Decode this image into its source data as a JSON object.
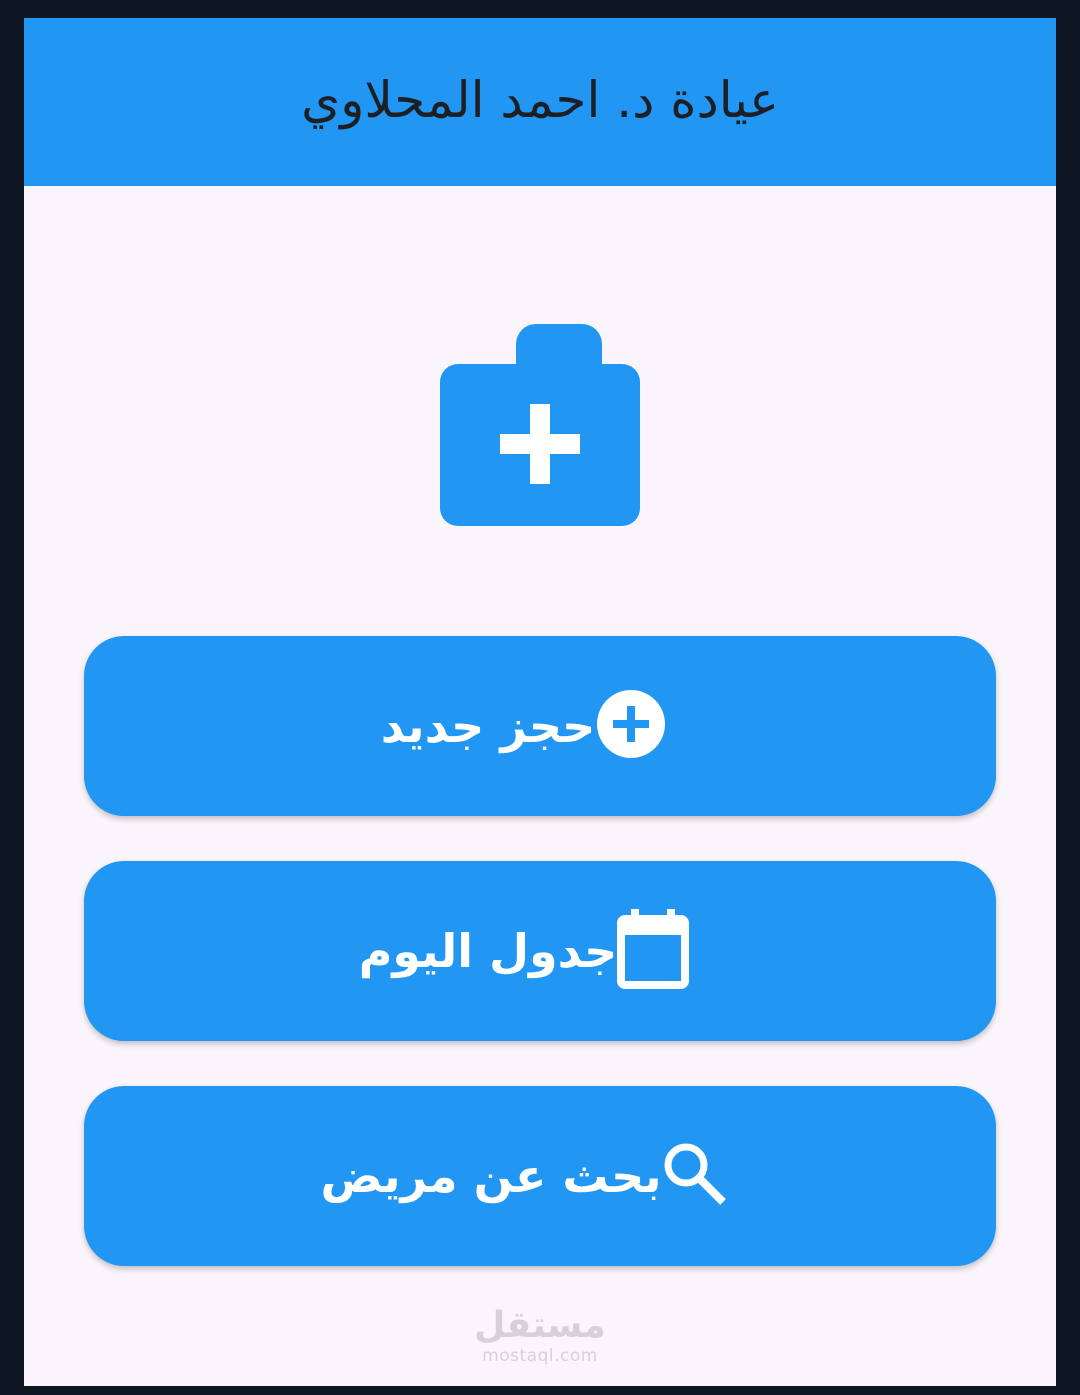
{
  "app_bar": {
    "title": "عيادة د. احمد المحلاوي",
    "color": "#2196f3"
  },
  "logo": {
    "icon": "medical-bag-icon",
    "color": "#2196f3"
  },
  "buttons": [
    {
      "label": "حجز جديد",
      "icon": "add-circle-icon"
    },
    {
      "label": "جدول اليوم",
      "icon": "calendar-icon"
    },
    {
      "label": "بحث عن مريض",
      "icon": "search-icon"
    }
  ],
  "watermark": {
    "arabic": "مستقل",
    "latin": "mostaql.com"
  },
  "colors": {
    "accent": "#2196f3",
    "background": "#faf5fb",
    "frame": "#0e1621",
    "title_text": "#1d1f24"
  }
}
